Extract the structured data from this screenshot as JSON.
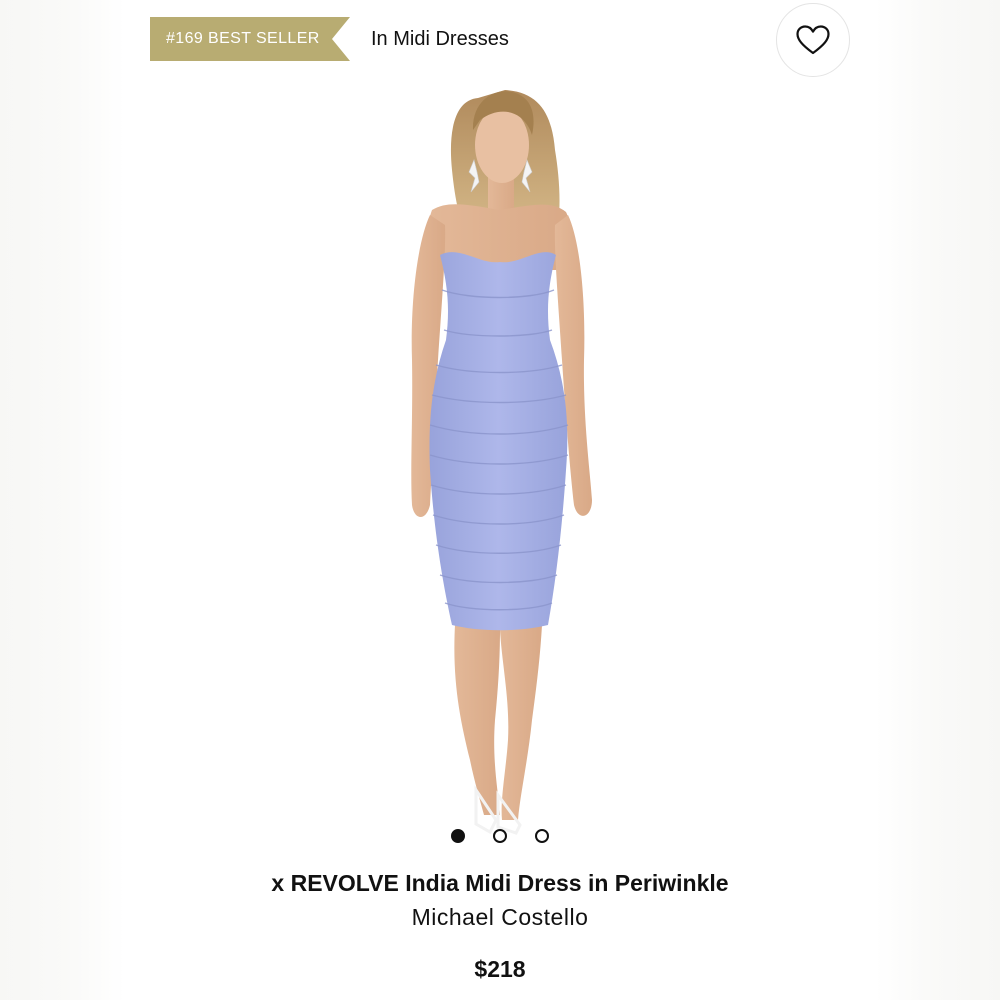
{
  "header": {
    "badge_label": "#169 BEST SELLER",
    "category_link": "In Midi Dresses",
    "favorite_icon": "heart-outline-icon"
  },
  "product": {
    "title": "x REVOLVE India Midi Dress in Periwinkle",
    "brand": "Michael Costello",
    "price": "$218",
    "image_alt": "Model wearing a periwinkle strapless ruched midi dress"
  },
  "carousel": {
    "total": 3,
    "active_index": 0
  },
  "colors": {
    "badge": "#b8ac72",
    "dress": "#a9b2e6",
    "text": "#111111"
  }
}
